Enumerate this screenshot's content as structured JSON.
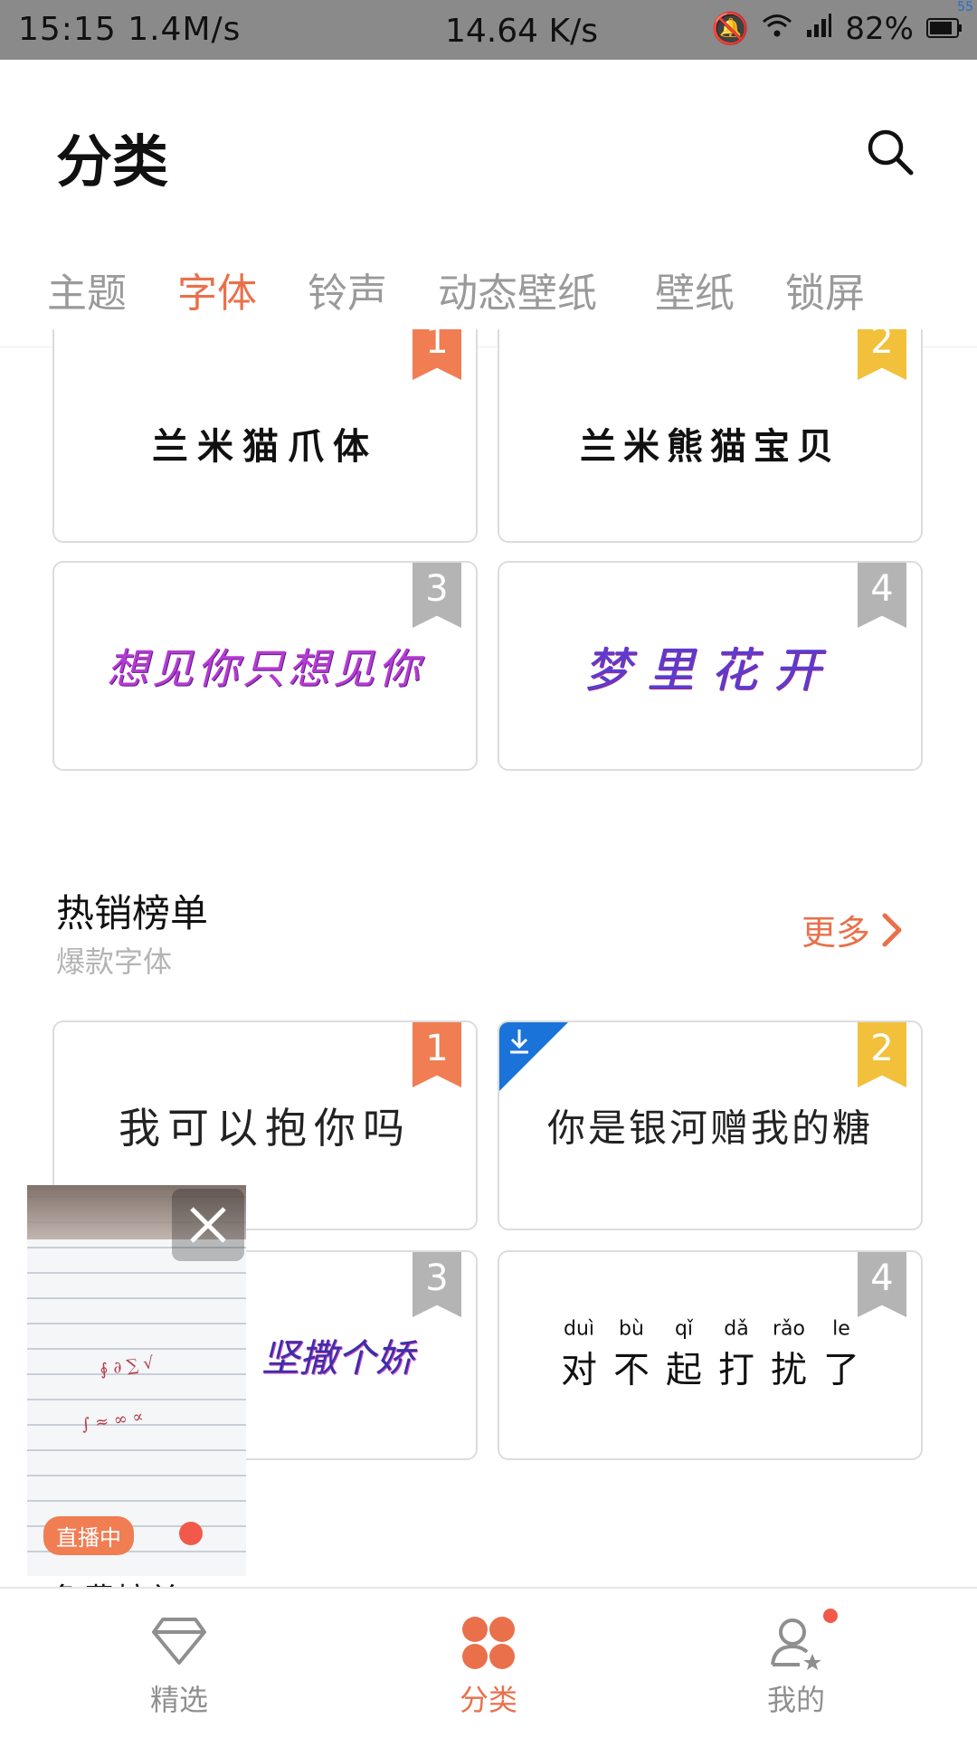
{
  "status_bar": {
    "left_text": "15:15 1.4M/s",
    "center_text": "14.64 K/s",
    "battery_text": "82%",
    "corner_text": "55",
    "icons": [
      "bluetooth-icon",
      "mail-icon",
      "video-icon",
      "more-icon",
      "mute-icon",
      "wifi-icon",
      "signal-icon",
      "battery-icon"
    ]
  },
  "header": {
    "title": "分类",
    "search_icon": "search-icon"
  },
  "tabs": [
    {
      "label": "主题"
    },
    {
      "label": "字体"
    },
    {
      "label": "铃声"
    },
    {
      "label": "动态壁纸"
    },
    {
      "label": "壁纸"
    },
    {
      "label": "锁屏"
    }
  ],
  "top_grid": [
    {
      "rank": "1",
      "name": "兰米猫爪体"
    },
    {
      "rank": "2",
      "name": "兰米熊猫宝贝"
    },
    {
      "rank": "3",
      "name": "想见你只想见你"
    },
    {
      "rank": "4",
      "name": "梦里花开"
    }
  ],
  "hot_section": {
    "title": "热销榜单",
    "subtitle": "爆款字体",
    "more_label": "更多"
  },
  "hot_grid": [
    {
      "rank": "1",
      "name": "我可以抱你吗"
    },
    {
      "rank": "2",
      "name": "你是银河赠我的糖"
    },
    {
      "rank": "3",
      "name": "坚撒个娇"
    },
    {
      "rank": "4",
      "name": "对不起打扰了",
      "pinyin": [
        {
          "p": "duì",
          "h": "对"
        },
        {
          "p": "bù",
          "h": "不"
        },
        {
          "p": "qǐ",
          "h": "起"
        },
        {
          "p": "dǎ",
          "h": "打"
        },
        {
          "p": "rǎo",
          "h": "扰"
        },
        {
          "p": "le",
          "h": "了"
        }
      ]
    }
  ],
  "next_section_partial": "免费榜单",
  "float_video": {
    "live_label": "直播中"
  },
  "bottom_nav": [
    {
      "label": "精选",
      "icon": "diamond-icon"
    },
    {
      "label": "分类",
      "icon": "clover-grid-icon"
    },
    {
      "label": "我的",
      "icon": "user-star-icon"
    }
  ],
  "colors": {
    "accent": "#e9704b",
    "rank1": "#f17d53",
    "rank2": "#f2c03a",
    "rank_gray": "#b4b4b4",
    "download_blue": "#1a73d9"
  }
}
